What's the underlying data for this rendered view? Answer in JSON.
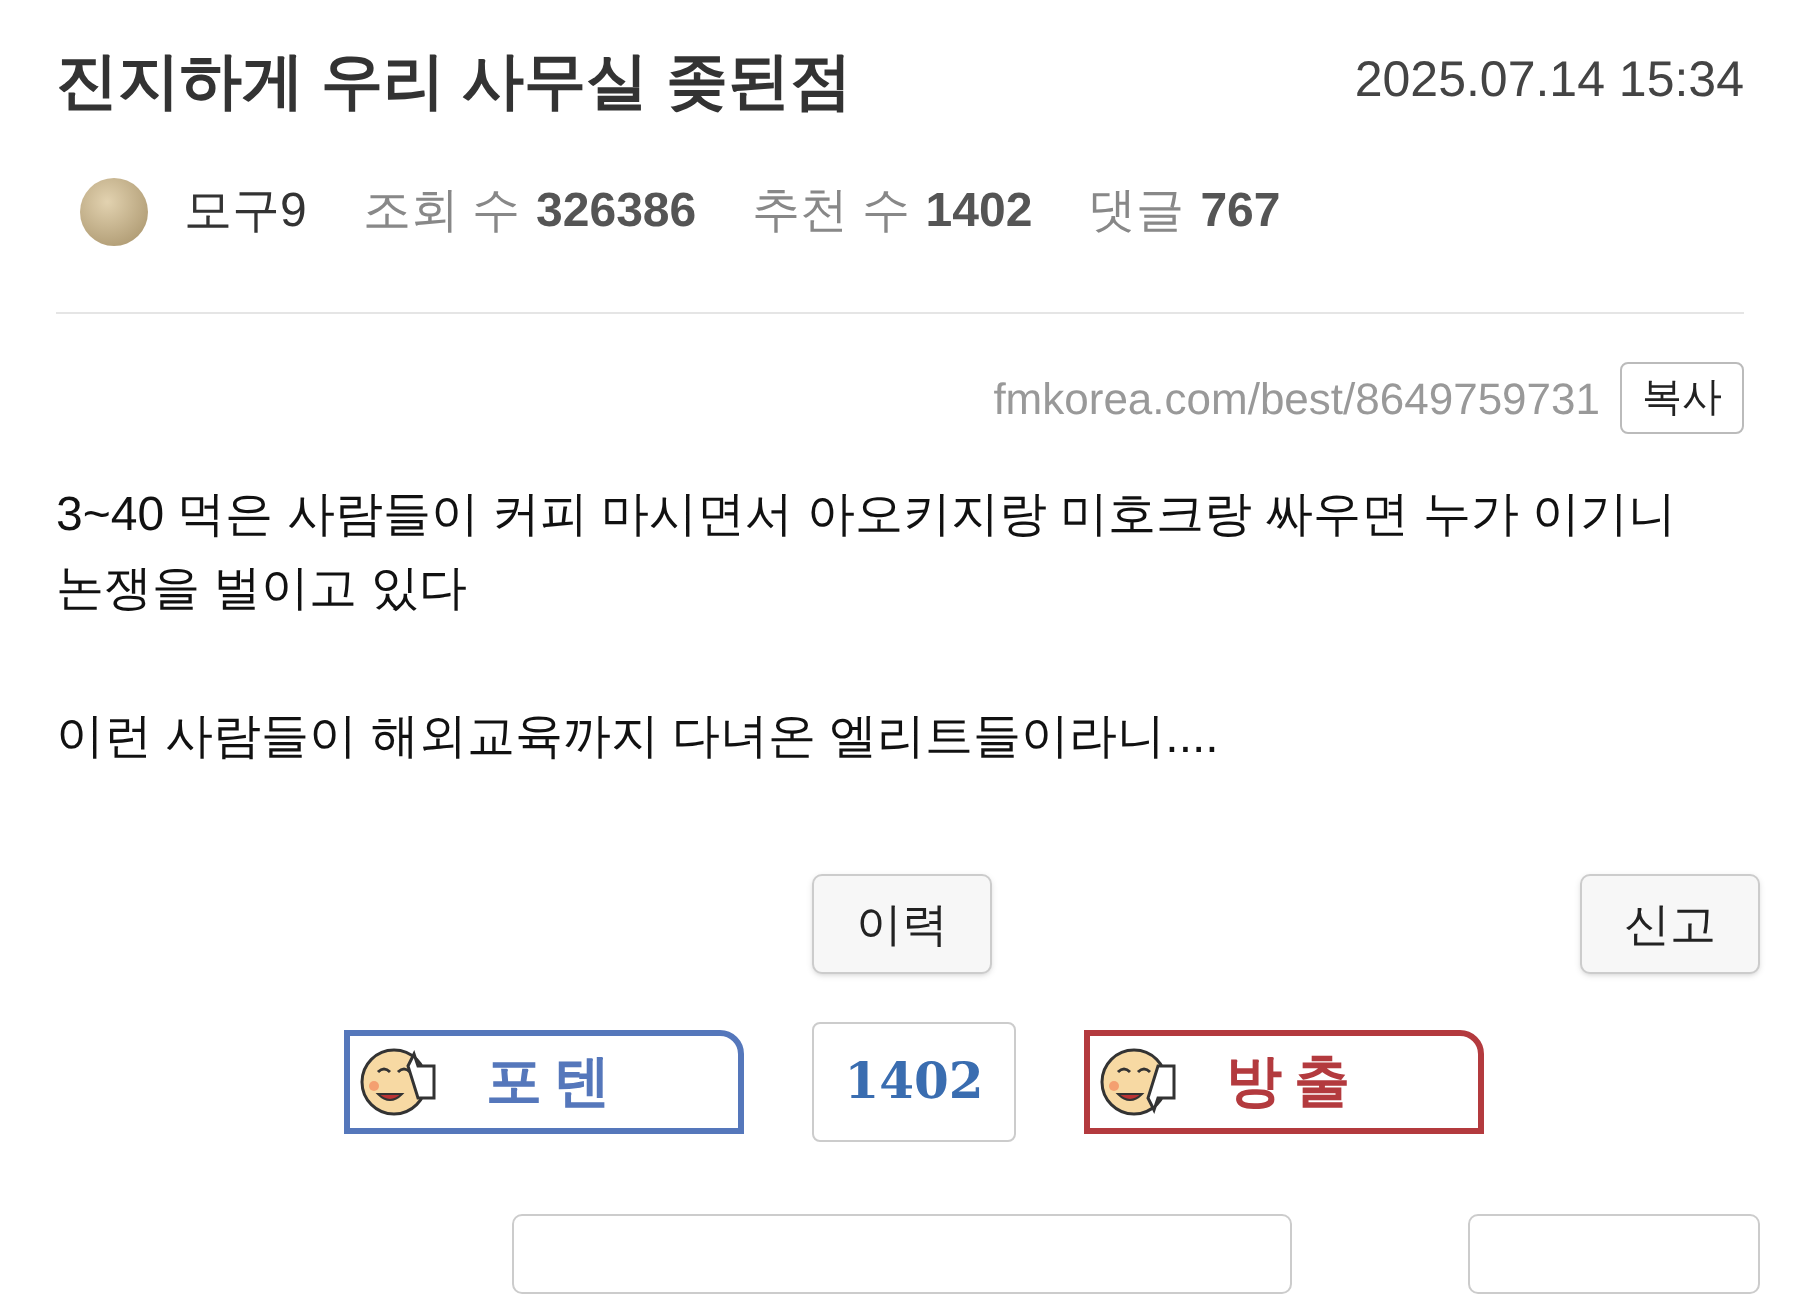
{
  "post": {
    "title": "진지하게 우리 사무실 좆된점",
    "date": "2025.07.14 15:34"
  },
  "meta": {
    "author": "모구9",
    "stats": [
      {
        "label": "조회 수",
        "value": "326386"
      },
      {
        "label": "추천 수",
        "value": "1402"
      },
      {
        "label": "댓글",
        "value": "767"
      }
    ]
  },
  "link": {
    "url": "fmkorea.com/best/8649759731",
    "copy_button": "복사"
  },
  "body": [
    "3~40 먹은 사람들이 커피 마시면서 아오키지랑 미호크랑 싸우면 누가 이기니 논쟁을 벌이고 있다",
    "이런 사람들이 해외교육까지 다녀온 엘리트들이라니...."
  ],
  "actions": {
    "history_button": "이력",
    "report_button": "신고"
  },
  "votes": {
    "up": {
      "label": "포텐",
      "color": "#5577bb"
    },
    "count": "1402",
    "down": {
      "label": "방출",
      "color": "#b33a3e"
    }
  }
}
